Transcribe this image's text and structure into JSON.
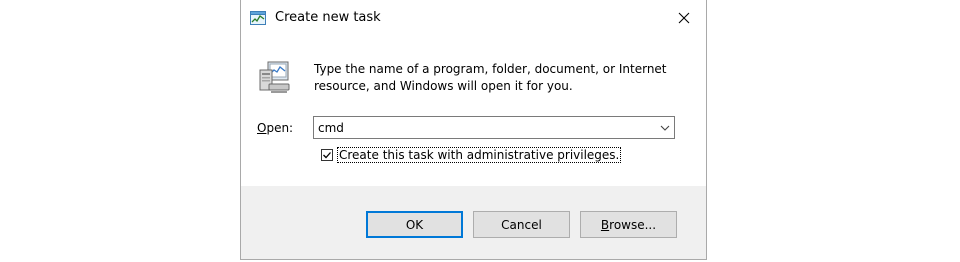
{
  "window": {
    "title": "Create new task",
    "title_icon": "task-manager-icon",
    "close_icon": "close-icon"
  },
  "main": {
    "icon": "run-dialog-icon",
    "description": "Type the name of a program, folder, document, or Internet resource, and Windows will open it for you.",
    "open_label_accel": "O",
    "open_label_rest": "pen:",
    "open_value": "cmd",
    "dropdown_icon": "chevron-down-icon",
    "admin_checkbox_label": "Create this task with administrative privileges.",
    "admin_checked": true
  },
  "buttons": {
    "ok": "OK",
    "cancel": "Cancel",
    "browse_accel": "B",
    "browse_rest": "rowse..."
  },
  "colors": {
    "accent": "#0078d7",
    "footer_bg": "#f0f0f0",
    "button_bg": "#e1e1e1"
  }
}
